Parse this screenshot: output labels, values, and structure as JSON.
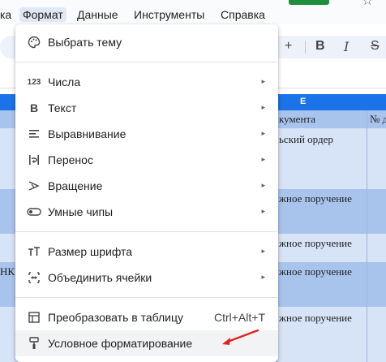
{
  "menubar": {
    "items": [
      "ка",
      "Формат",
      "Данные",
      "Инструменты",
      "Справка"
    ],
    "active_index": 1
  },
  "toolbar": {
    "plus": "+",
    "bold": "B",
    "italic": "I",
    "strike": "S"
  },
  "sheet": {
    "column_e": "E",
    "header_text_1": "кумента",
    "header_text_2": "№ д",
    "cells": [
      "ьский ордер",
      "жное поручение",
      "жное поручение",
      "жное поручение",
      "жное поручение"
    ],
    "left_fragment": "НК\""
  },
  "menu": {
    "items": [
      {
        "icon": "palette-icon",
        "label": "Выбрать тему",
        "submenu": false
      },
      {
        "icon": "number-format-icon",
        "label": "Числа",
        "submenu": true
      },
      {
        "icon": "bold-text-icon",
        "label": "Текст",
        "submenu": true
      },
      {
        "icon": "align-icon",
        "label": "Выравнивание",
        "submenu": true
      },
      {
        "icon": "text-wrap-icon",
        "label": "Перенос",
        "submenu": true
      },
      {
        "icon": "text-rotate-icon",
        "label": "Вращение",
        "submenu": true
      },
      {
        "icon": "smart-chips-icon",
        "label": "Умные чипы",
        "submenu": true
      },
      {
        "icon": "font-size-icon",
        "label": "Размер шрифта",
        "submenu": true
      },
      {
        "icon": "merge-cells-icon",
        "label": "Объединить ячейки",
        "submenu": true
      },
      {
        "icon": "table-icon",
        "label": "Преобразовать в таблицу",
        "shortcut": "Ctrl+Alt+T"
      },
      {
        "icon": "paint-roller-icon",
        "label": "Условное форматирование",
        "submenu": false
      }
    ],
    "number_icon_text": "123",
    "bold_icon_text": "B",
    "arrow_glyph": "▸"
  },
  "colors": {
    "accent": "#1a73e8",
    "menu_active_bg": "#e1e8f4",
    "row_light": "#d7e3f6",
    "row_dark": "#a9c4ec",
    "annotation": "#e32222"
  }
}
